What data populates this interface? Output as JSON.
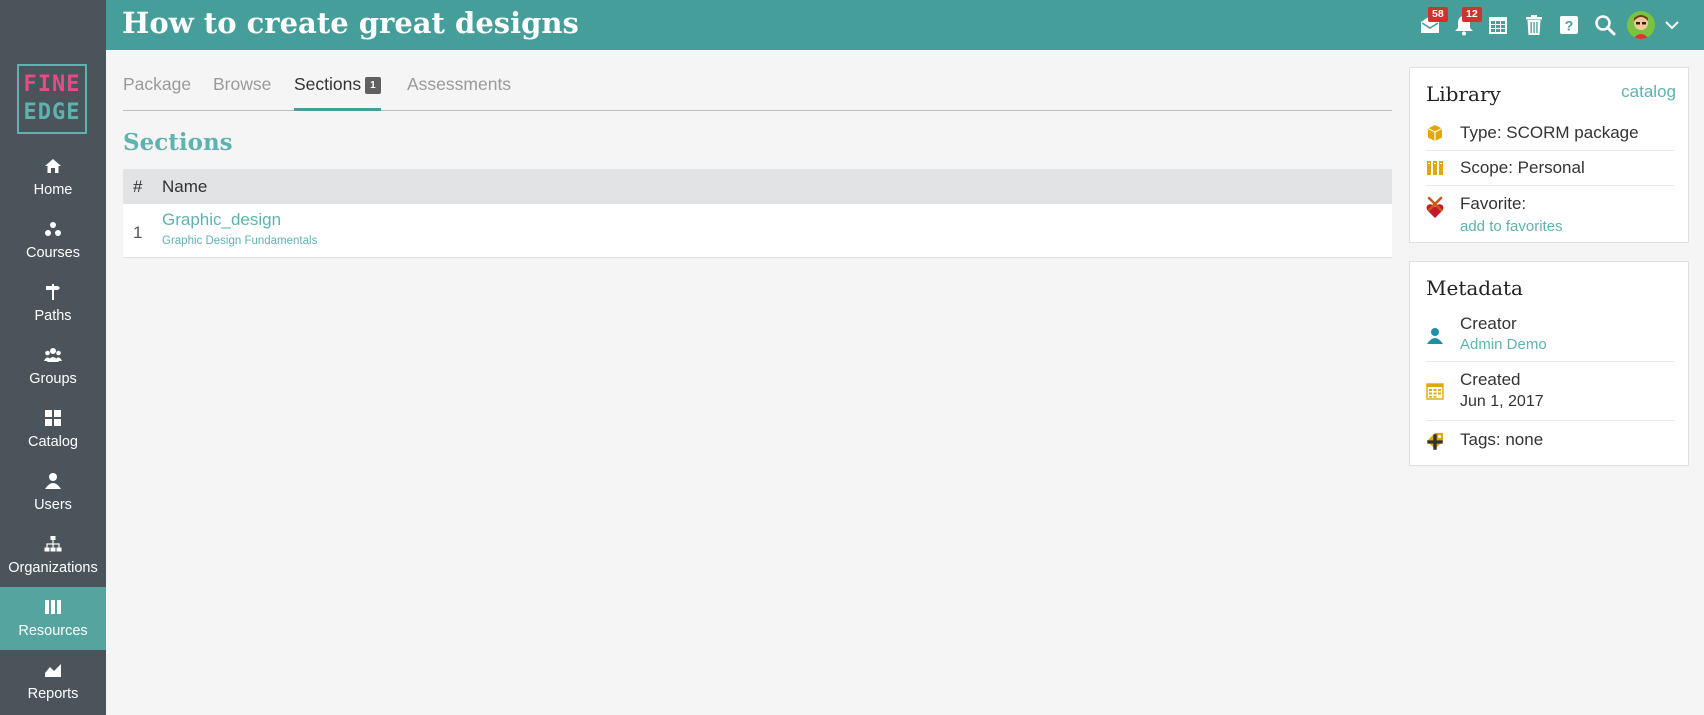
{
  "app": {
    "logo": {
      "line1": "FINE",
      "line2": "EDGE"
    }
  },
  "header": {
    "title": "How to create great designs",
    "messages_count": "58",
    "notifications_count": "12"
  },
  "sidebar": {
    "items": [
      {
        "label": "Home",
        "icon": "home-icon"
      },
      {
        "label": "Courses",
        "icon": "courses-icon"
      },
      {
        "label": "Paths",
        "icon": "signpost-icon"
      },
      {
        "label": "Groups",
        "icon": "users-group-icon"
      },
      {
        "label": "Catalog",
        "icon": "grid-icon"
      },
      {
        "label": "Users",
        "icon": "user-icon"
      },
      {
        "label": "Organizations",
        "icon": "org-chart-icon"
      },
      {
        "label": "Resources",
        "icon": "books-icon",
        "active": true
      },
      {
        "label": "Reports",
        "icon": "area-chart-icon"
      }
    ]
  },
  "tabs": [
    {
      "label": "Package"
    },
    {
      "label": "Browse"
    },
    {
      "label": "Sections",
      "badge": "1",
      "active": true
    },
    {
      "label": "Assessments"
    }
  ],
  "sections": {
    "heading": "Sections",
    "columns": [
      "#",
      "Name"
    ],
    "rows": [
      {
        "num": "1",
        "name": "Graphic_design",
        "subtitle": "Graphic Design Fundamentals"
      }
    ]
  },
  "library": {
    "title": "Library",
    "catalog_link": "catalog",
    "type": "Type: SCORM package",
    "scope": "Scope: Personal",
    "favorite_label": "Favorite:",
    "add_favorites": "add to favorites"
  },
  "metadata": {
    "title": "Metadata",
    "creator_label": "Creator",
    "creator_value": "Admin Demo",
    "created_label": "Created",
    "created_value": "Jun 1, 2017",
    "tags": "Tags: none"
  },
  "colors": {
    "header": "#459e9a",
    "sidebar": "#4b535b",
    "accent": "#5eb3b0",
    "badge": "#d0322e",
    "icon_gold": "#e0a800"
  }
}
